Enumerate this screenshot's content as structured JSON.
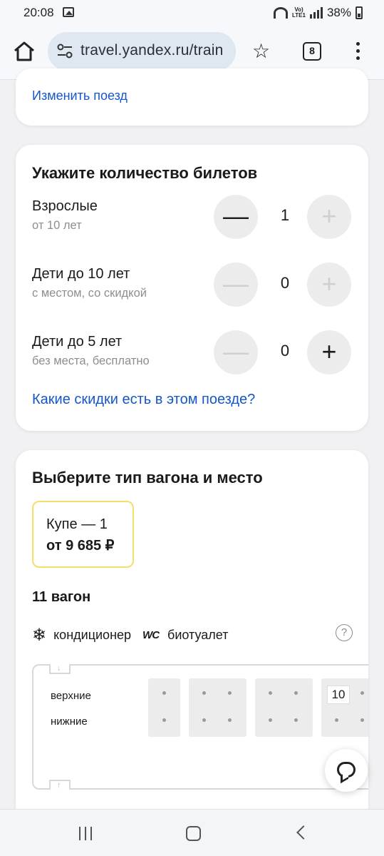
{
  "status_bar": {
    "time": "20:08",
    "network": "Vo) LTE1",
    "battery": "38%"
  },
  "browser": {
    "url": "travel.yandex.ru/train",
    "tab_count": "8"
  },
  "train_card": {
    "change_link": "Изменить поезд"
  },
  "tickets": {
    "title": "Укажите количество билетов",
    "rows": [
      {
        "label": "Взрослые",
        "sub": "от 10 лет",
        "count": "1",
        "minus": "—",
        "plus": "+",
        "minus_enabled": true,
        "plus_enabled": false
      },
      {
        "label": "Дети до 10 лет",
        "sub": "с местом, со скидкой",
        "count": "0",
        "minus": "—",
        "plus": "+",
        "minus_enabled": false,
        "plus_enabled": false
      },
      {
        "label": "Дети до 5 лет",
        "sub": "без места, бесплатно",
        "count": "0",
        "minus": "—",
        "plus": "+",
        "minus_enabled": false,
        "plus_enabled": true
      }
    ],
    "discount_link": "Какие скидки есть в этом поезде?"
  },
  "wagon_select": {
    "title": "Выберите тип вагона и место",
    "tariff": {
      "type": "Купе — 1",
      "price": "от 9 685 ₽",
      "accent_color": "#f4de6a"
    },
    "wagon_number": "11 вагон",
    "amenities": [
      {
        "icon": "snowflake-icon",
        "label": "кондиционер"
      },
      {
        "icon": "wc-icon",
        "label": "биотуалет"
      }
    ],
    "help": "?",
    "scheme": {
      "upper_label": "верхние",
      "lower_label": "нижние",
      "visible_seat_number": "10"
    }
  },
  "colors": {
    "link": "#1656c8",
    "background": "#f1f1f4"
  }
}
